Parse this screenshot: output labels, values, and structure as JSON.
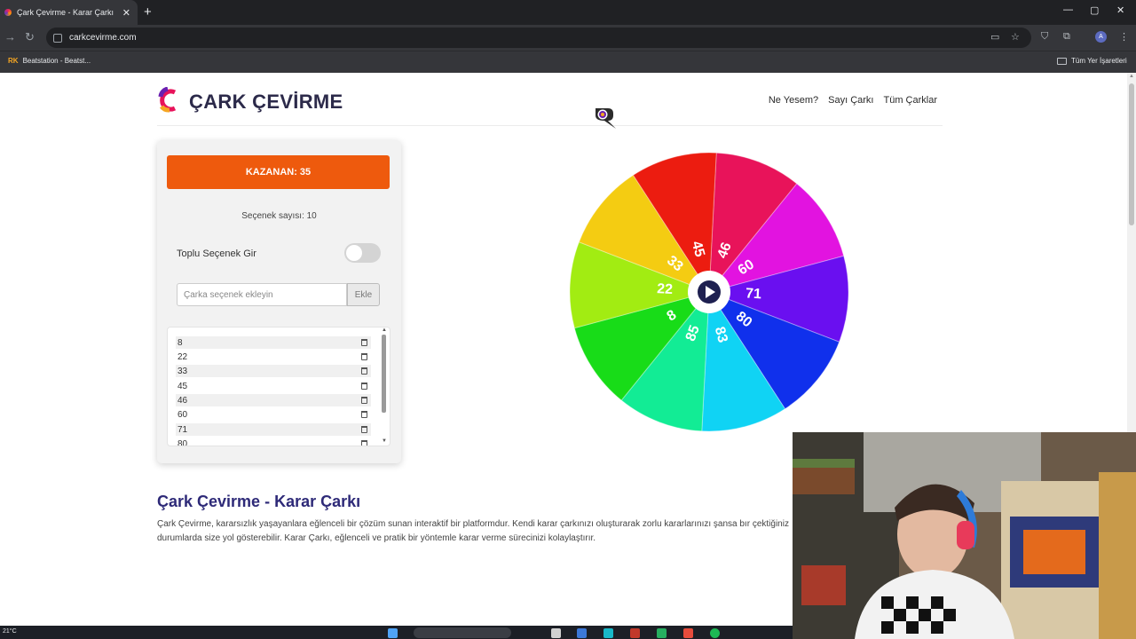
{
  "browser": {
    "tab_title": "Çark Çevirme - Karar Çarkı",
    "tab_close": "✕",
    "new_tab": "+",
    "url": "carkcevirme.com",
    "window_controls": [
      "—",
      "▢",
      "✕"
    ],
    "bookmarks": [
      {
        "label": "Beatstation - Beatst...",
        "icon": "RK"
      }
    ],
    "bookmarks_all": "Tüm Yer İşaretleri",
    "profile_initial": "A"
  },
  "site": {
    "brand": "ÇARK ÇEVİRME",
    "nav": [
      "Ne Yesem?",
      "Sayı Çarkı",
      "Tüm Çarklar"
    ]
  },
  "panel": {
    "winner": "KAZANAN: 35",
    "count_label": "Seçenek sayısı: 10",
    "bulk_label": "Toplu Seçenek Gir",
    "input_placeholder": "Çarka seçenek ekleyin",
    "add_button": "Ekle",
    "options": [
      "8",
      "22",
      "33",
      "45",
      "46",
      "60",
      "71",
      "80"
    ]
  },
  "wheel": {
    "segments": [
      {
        "label": "46",
        "color": "#e8135a"
      },
      {
        "label": "60",
        "color": "#e213e0"
      },
      {
        "label": "71",
        "color": "#6a0ff0"
      },
      {
        "label": "80",
        "color": "#1030ec"
      },
      {
        "label": "83",
        "color": "#10d3f4"
      },
      {
        "label": "85",
        "color": "#12ec95"
      },
      {
        "label": "8",
        "color": "#18dc18"
      },
      {
        "label": "22",
        "color": "#a2ec12"
      },
      {
        "label": "33",
        "color": "#f4cc12"
      },
      {
        "label": "45",
        "color": "#ec1c10"
      }
    ]
  },
  "article": {
    "title": "Çark Çevirme - Karar Çarkı",
    "body": "Çark Çevirme, kararsızlık yaşayanlara eğlenceli bir çözüm sunan interaktif bir platformdur. Kendi karar çarkınızı oluşturarak zorlu kararlarınızı şansa bır çektiğiniz durumlarda size yol gösterebilir. Karar Çarkı, eğlenceli ve pratik bir yöntemle karar verme sürecinizi kolaylaştırır."
  },
  "taskbar": {
    "temperature": "21°C"
  },
  "colors": {
    "winner_bg": "#ee5a0d",
    "brand_text": "#2c2a4a",
    "title_text": "#2e2a78"
  }
}
